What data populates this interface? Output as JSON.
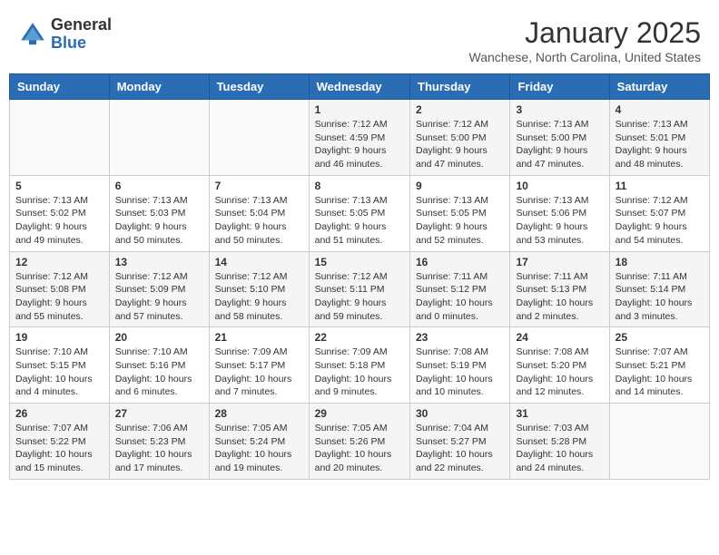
{
  "header": {
    "logo_general": "General",
    "logo_blue": "Blue",
    "month": "January 2025",
    "location": "Wanchese, North Carolina, United States"
  },
  "weekdays": [
    "Sunday",
    "Monday",
    "Tuesday",
    "Wednesday",
    "Thursday",
    "Friday",
    "Saturday"
  ],
  "weeks": [
    [
      {
        "day": "",
        "info": ""
      },
      {
        "day": "",
        "info": ""
      },
      {
        "day": "",
        "info": ""
      },
      {
        "day": "1",
        "info": "Sunrise: 7:12 AM\nSunset: 4:59 PM\nDaylight: 9 hours\nand 46 minutes."
      },
      {
        "day": "2",
        "info": "Sunrise: 7:12 AM\nSunset: 5:00 PM\nDaylight: 9 hours\nand 47 minutes."
      },
      {
        "day": "3",
        "info": "Sunrise: 7:13 AM\nSunset: 5:00 PM\nDaylight: 9 hours\nand 47 minutes."
      },
      {
        "day": "4",
        "info": "Sunrise: 7:13 AM\nSunset: 5:01 PM\nDaylight: 9 hours\nand 48 minutes."
      }
    ],
    [
      {
        "day": "5",
        "info": "Sunrise: 7:13 AM\nSunset: 5:02 PM\nDaylight: 9 hours\nand 49 minutes."
      },
      {
        "day": "6",
        "info": "Sunrise: 7:13 AM\nSunset: 5:03 PM\nDaylight: 9 hours\nand 50 minutes."
      },
      {
        "day": "7",
        "info": "Sunrise: 7:13 AM\nSunset: 5:04 PM\nDaylight: 9 hours\nand 50 minutes."
      },
      {
        "day": "8",
        "info": "Sunrise: 7:13 AM\nSunset: 5:05 PM\nDaylight: 9 hours\nand 51 minutes."
      },
      {
        "day": "9",
        "info": "Sunrise: 7:13 AM\nSunset: 5:05 PM\nDaylight: 9 hours\nand 52 minutes."
      },
      {
        "day": "10",
        "info": "Sunrise: 7:13 AM\nSunset: 5:06 PM\nDaylight: 9 hours\nand 53 minutes."
      },
      {
        "day": "11",
        "info": "Sunrise: 7:12 AM\nSunset: 5:07 PM\nDaylight: 9 hours\nand 54 minutes."
      }
    ],
    [
      {
        "day": "12",
        "info": "Sunrise: 7:12 AM\nSunset: 5:08 PM\nDaylight: 9 hours\nand 55 minutes."
      },
      {
        "day": "13",
        "info": "Sunrise: 7:12 AM\nSunset: 5:09 PM\nDaylight: 9 hours\nand 57 minutes."
      },
      {
        "day": "14",
        "info": "Sunrise: 7:12 AM\nSunset: 5:10 PM\nDaylight: 9 hours\nand 58 minutes."
      },
      {
        "day": "15",
        "info": "Sunrise: 7:12 AM\nSunset: 5:11 PM\nDaylight: 9 hours\nand 59 minutes."
      },
      {
        "day": "16",
        "info": "Sunrise: 7:11 AM\nSunset: 5:12 PM\nDaylight: 10 hours\nand 0 minutes."
      },
      {
        "day": "17",
        "info": "Sunrise: 7:11 AM\nSunset: 5:13 PM\nDaylight: 10 hours\nand 2 minutes."
      },
      {
        "day": "18",
        "info": "Sunrise: 7:11 AM\nSunset: 5:14 PM\nDaylight: 10 hours\nand 3 minutes."
      }
    ],
    [
      {
        "day": "19",
        "info": "Sunrise: 7:10 AM\nSunset: 5:15 PM\nDaylight: 10 hours\nand 4 minutes."
      },
      {
        "day": "20",
        "info": "Sunrise: 7:10 AM\nSunset: 5:16 PM\nDaylight: 10 hours\nand 6 minutes."
      },
      {
        "day": "21",
        "info": "Sunrise: 7:09 AM\nSunset: 5:17 PM\nDaylight: 10 hours\nand 7 minutes."
      },
      {
        "day": "22",
        "info": "Sunrise: 7:09 AM\nSunset: 5:18 PM\nDaylight: 10 hours\nand 9 minutes."
      },
      {
        "day": "23",
        "info": "Sunrise: 7:08 AM\nSunset: 5:19 PM\nDaylight: 10 hours\nand 10 minutes."
      },
      {
        "day": "24",
        "info": "Sunrise: 7:08 AM\nSunset: 5:20 PM\nDaylight: 10 hours\nand 12 minutes."
      },
      {
        "day": "25",
        "info": "Sunrise: 7:07 AM\nSunset: 5:21 PM\nDaylight: 10 hours\nand 14 minutes."
      }
    ],
    [
      {
        "day": "26",
        "info": "Sunrise: 7:07 AM\nSunset: 5:22 PM\nDaylight: 10 hours\nand 15 minutes."
      },
      {
        "day": "27",
        "info": "Sunrise: 7:06 AM\nSunset: 5:23 PM\nDaylight: 10 hours\nand 17 minutes."
      },
      {
        "day": "28",
        "info": "Sunrise: 7:05 AM\nSunset: 5:24 PM\nDaylight: 10 hours\nand 19 minutes."
      },
      {
        "day": "29",
        "info": "Sunrise: 7:05 AM\nSunset: 5:26 PM\nDaylight: 10 hours\nand 20 minutes."
      },
      {
        "day": "30",
        "info": "Sunrise: 7:04 AM\nSunset: 5:27 PM\nDaylight: 10 hours\nand 22 minutes."
      },
      {
        "day": "31",
        "info": "Sunrise: 7:03 AM\nSunset: 5:28 PM\nDaylight: 10 hours\nand 24 minutes."
      },
      {
        "day": "",
        "info": ""
      }
    ]
  ]
}
